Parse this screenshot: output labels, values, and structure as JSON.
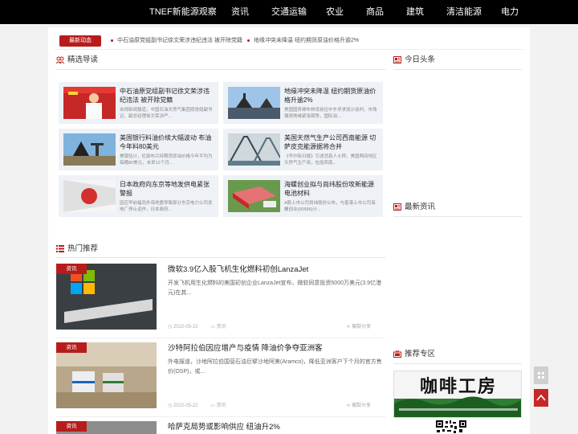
{
  "nav": {
    "brand": "TNEF新能源观察",
    "items": [
      "资讯",
      "交通运输",
      "农业",
      "商品",
      "建筑",
      "清洁能源",
      "电力"
    ]
  },
  "ticker": {
    "label": "最新动态",
    "items": [
      "中石油原党组副书记徐文荣涉违纪违法 被开除党籍",
      "地缘冲突未降温 纽约期货原油价格升逾2%"
    ]
  },
  "featured": {
    "title": "精选导读",
    "cards": [
      {
        "title": "中石油原党组副书记徐文荣涉违纪违法 被开除党籍",
        "desc": "央视新闻报道，中国石油天然气集团原党组副书记、副总经理徐文荣涉严..."
      },
      {
        "title": "地缘冲突未降温 纽约期货原油价格升逾2%",
        "desc": "美国国务卿布林肯前往中东寻求加沙谈判，市场揣测地缘紧张局势，国际油..."
      },
      {
        "title": "美国银行料油价续大幅波动 布油今年料80美元",
        "desc": "美银估计，伦敦布兰特期货原油价格今年平均为每桶80美元，未来12个月..."
      },
      {
        "title": "美国天然气生产公司西南能源 切萨皮克能源据将合并",
        "desc": "《华尔街日报》引述消息人士称，美国两间地区天然气生产商，包括西南..."
      },
      {
        "title": "日本政府向东京等地发供电紧张警报",
        "desc": "因应早前福岛外海地震导致部分东京电力公司发电厂停止运作，日本政府..."
      },
      {
        "title": "海螺创业拟与尚纬股份攻新能源电池材料",
        "desc": "A股上市公司尚纬股份公布，与香港上市公司海螺创业(00586)计..."
      }
    ]
  },
  "hot": {
    "title": "热门推荐",
    "items": [
      {
        "category": "资讯",
        "title": "微软3.9亿入股飞机生化燃料初创LanzaJet",
        "desc": "开发飞机用生化燃料的美国初创企业LanzaJet宣布，微软同意投资5000万美元(3.9亿港元)在其...",
        "date": "2022-05-22",
        "tag": "资讯",
        "share": "複製分享"
      },
      {
        "category": "资讯",
        "title": "沙特阿拉伯因应增产与疫情 降油价争夺亚洲客",
        "desc": "外电报道，沙地阿拉伯国营石油巨擘沙地阿美(Aramco)，降低亚洲客户下个月的官方售价(OSP)，或...",
        "date": "2022-05-22",
        "tag": "资讯",
        "share": "複製分享"
      },
      {
        "category": "资讯",
        "title": "哈萨克局势或影响供应 纽油升2%",
        "desc": "",
        "date": "",
        "tag": "",
        "share": ""
      }
    ]
  },
  "sidebar": {
    "headline_title": "今日头条",
    "latest_title": "最新资讯",
    "recommend_title": "推荐专区",
    "promo_text": "咖啡工房"
  },
  "floating": {
    "top_label": "返回顶部",
    "aux_label": "二维码"
  },
  "colors": {
    "accent": "#b71c1c",
    "nav_bg": "#000000",
    "card_bg": "#eef2f6"
  }
}
